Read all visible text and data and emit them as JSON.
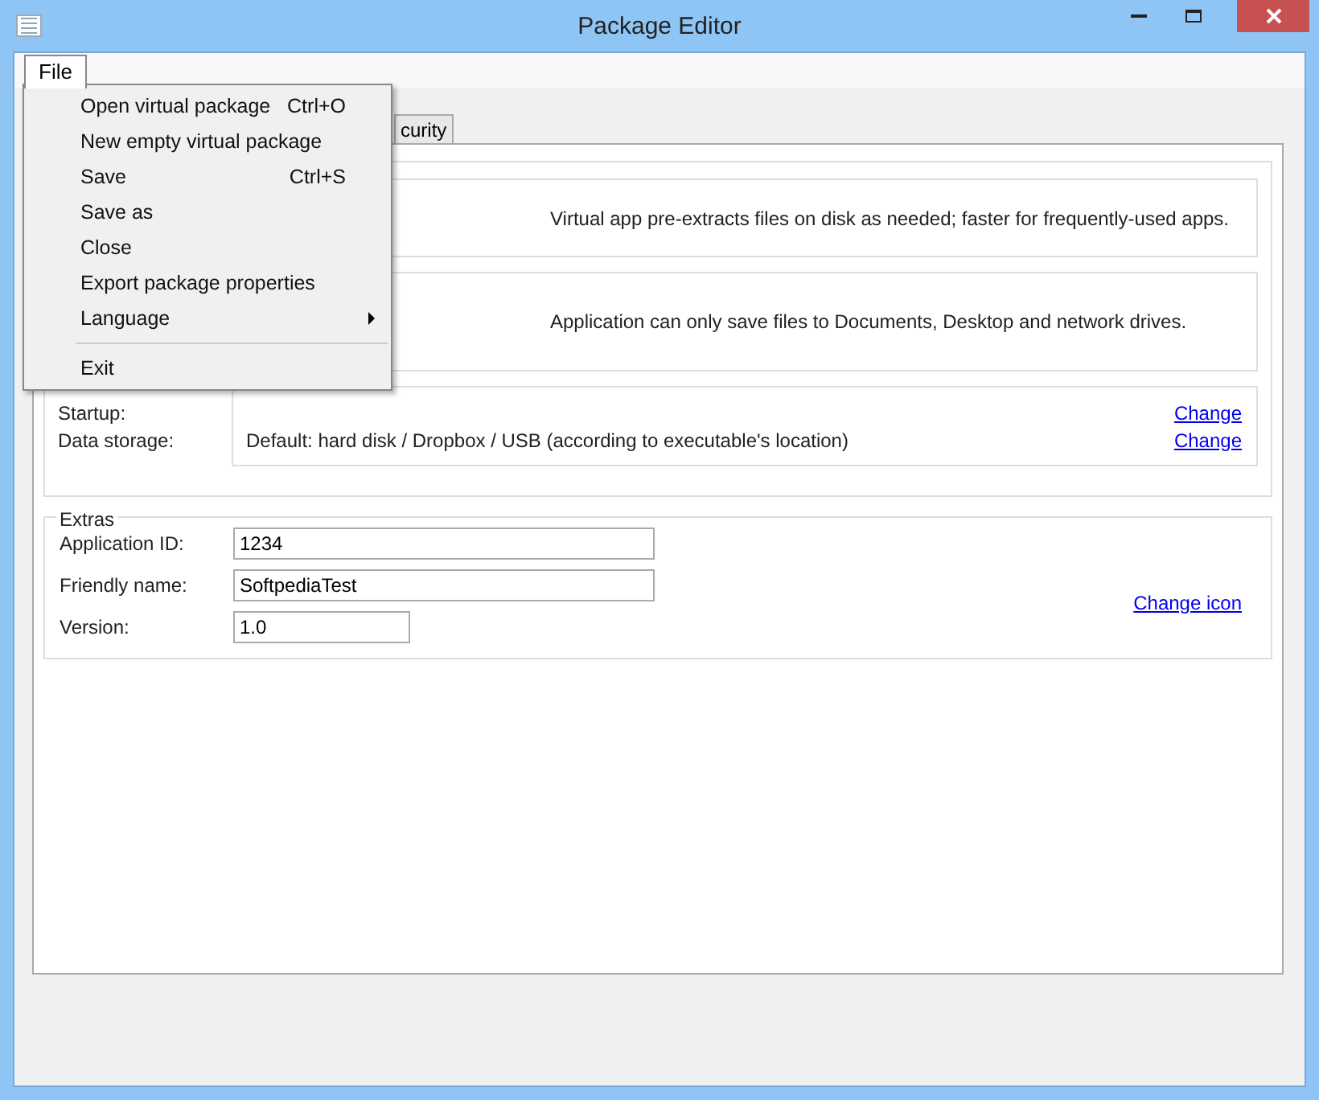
{
  "window": {
    "title": "Package Editor"
  },
  "menu_bar": [
    {
      "label": "File",
      "selected": true
    }
  ],
  "file_menu": [
    {
      "label": "Open virtual package",
      "shortcut": "Ctrl+O"
    },
    {
      "label": "New empty virtual package"
    },
    {
      "label": "Save",
      "shortcut": "Ctrl+S"
    },
    {
      "label": "Save as"
    },
    {
      "label": "Close"
    },
    {
      "label": "Export package properties"
    },
    {
      "label": "Language",
      "submenu": true
    },
    {
      "kind": "separator"
    },
    {
      "label": "Exit"
    }
  ],
  "tabs": [
    {
      "label": "curity",
      "selected": false
    }
  ],
  "panels": [
    {
      "text": "Virtual app pre-extracts files on disk as needed; faster for frequently-used apps."
    },
    {
      "text": "Application can only save files to Documents, Desktop and network drives."
    }
  ],
  "storage": {
    "rows": [
      {
        "label": "Startup:",
        "link": "Change"
      },
      {
        "label": "Data storage:",
        "value": "Default: hard disk / Dropbox / USB (according to executable's location)",
        "link": "Change"
      }
    ]
  },
  "extras": {
    "title": "Extras",
    "fields": [
      {
        "label": "Application ID:",
        "value": "1234",
        "wide": true
      },
      {
        "label": "Friendly name:",
        "value": "SoftpediaTest",
        "wide": true
      },
      {
        "label": "Version:",
        "value": "1.0",
        "wide": false
      }
    ],
    "link": "Change icon"
  }
}
